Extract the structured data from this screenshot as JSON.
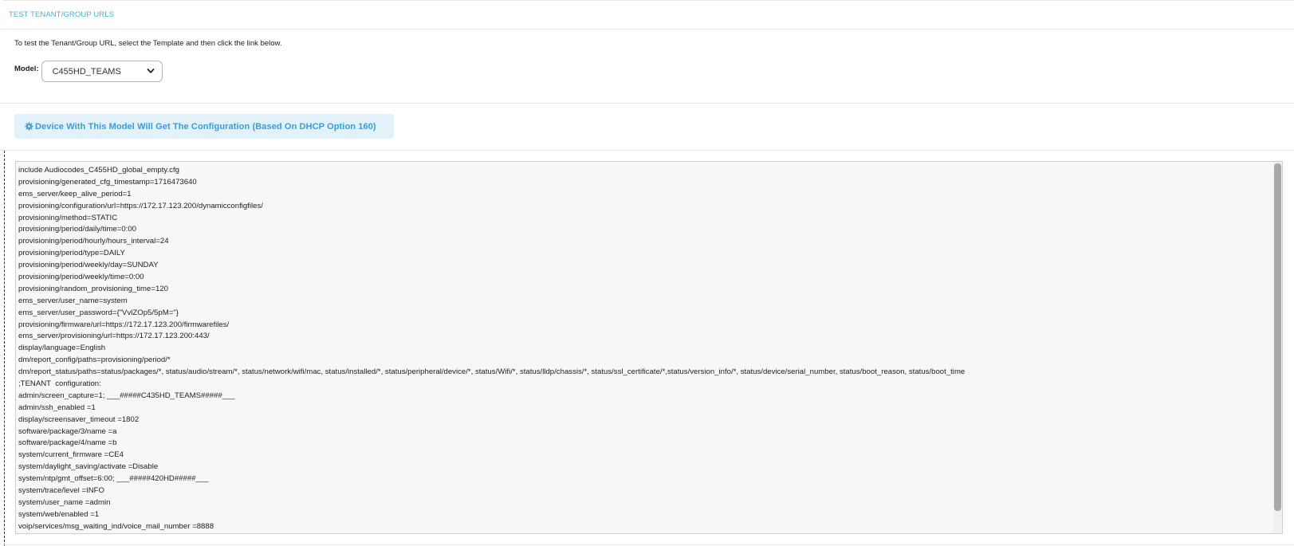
{
  "section": {
    "title": "TEST TENANT/GROUP URLS"
  },
  "instructions": "To test the Tenant/Group URL, select the Template and then click the link below.",
  "model": {
    "label": "Model:",
    "selected": "C455HD_TEAMS"
  },
  "banner": {
    "icon": "gear-icon",
    "text": "Device With This Model Will Get The Configuration (Based On DHCP Option 160)"
  },
  "config": {
    "lines": [
      "include Audiocodes_C455HD_global_empty.cfg",
      "provisioning/generated_cfg_timestamp=1716473640",
      "ems_server/keep_alive_period=1",
      "provisioning/configuration/url=https://172.17.123.200/dynamicconfigfiles/",
      "provisioning/method=STATIC",
      "provisioning/period/daily/time=0:00",
      "provisioning/period/hourly/hours_interval=24",
      "provisioning/period/type=DAILY",
      "provisioning/period/weekly/day=SUNDAY",
      "provisioning/period/weekly/time=0:00",
      "provisioning/random_provisioning_time=120",
      "ems_server/user_name=system",
      "ems_server/user_password={\"VvlZOp5/5pM=\"}",
      "provisioning/firmware/url=https://172.17.123.200/firmwarefiles/",
      "ems_server/provisioning/url=https://172.17.123.200:443/",
      "display/language=English",
      "dm/report_config/paths=provisioning/period/*",
      "dm/report_status/paths=status/packages/*, status/audio/stream/*, status/network/wifi/mac, status/installed/*, status/peripheral/device/*, status/Wifi/*, status/lldp/chassis/*, status/ssl_certificate/*,status/version_info/*, status/device/serial_number, status/boot_reason, status/boot_time",
      ";TENANT  configuration:",
      "admin/screen_capture=1; ___#####C435HD_TEAMS#####___",
      "admin/ssh_enabled =1",
      "display/screensaver_timeout =1802",
      "software/package/3/name =a",
      "software/package/4/name =b",
      "system/current_firmware =CE4",
      "system/daylight_saving/activate =Disable",
      "system/ntp/gmt_offset=6:00; ___#####420HD#####___",
      "system/trace/level =INFO",
      "system/user_name =admin",
      "system/web/enabled =1",
      "voip/services/msg_waiting_ind/voice_mail_number =8888"
    ]
  },
  "colors": {
    "accent": "#3a9ddb",
    "title": "#4aaee6",
    "banner_bg": "#e3f1fb",
    "config_bg": "#f7f7f7"
  }
}
